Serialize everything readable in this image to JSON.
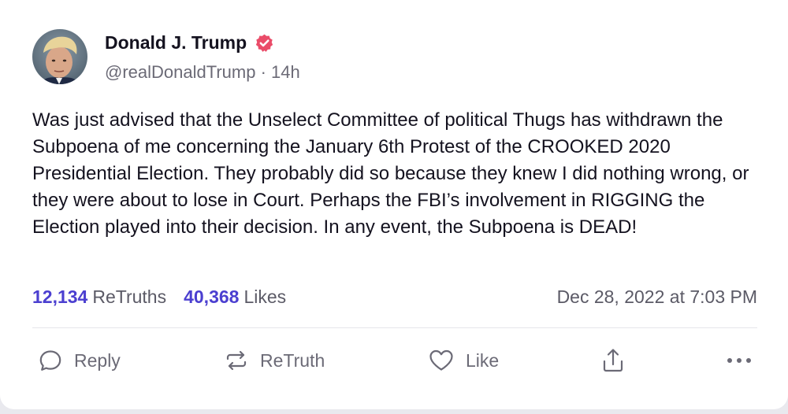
{
  "author": {
    "display_name": "Donald J. Trump",
    "handle": "@realDonaldTrump",
    "age": "14h",
    "verified": true,
    "verified_color": "#ea4c69"
  },
  "post": {
    "text": "Was just advised that the Unselect Committee of political Thugs has withdrawn the Subpoena of me concerning the January 6th Protest of the CROOKED 2020 Presidential Election. They probably did so because they knew I did nothing wrong, or they were about to lose in Court. Perhaps the FBI’s involvement in RIGGING the Election played into their decision. In any event, the Subpoena is DEAD!"
  },
  "stats": {
    "retruths_count": "12,134",
    "retruths_label": "ReTruths",
    "likes_count": "40,368",
    "likes_label": "Likes",
    "timestamp": "Dec 28, 2022 at 7:03 PM",
    "accent_color": "#4b3fd0"
  },
  "actions": {
    "reply": {
      "label": "Reply",
      "icon": "reply-icon"
    },
    "retruth": {
      "label": "ReTruth",
      "icon": "retruth-icon"
    },
    "like": {
      "label": "Like",
      "icon": "heart-icon"
    },
    "share": {
      "icon": "share-icon"
    },
    "more": {
      "icon": "more-icon"
    }
  }
}
